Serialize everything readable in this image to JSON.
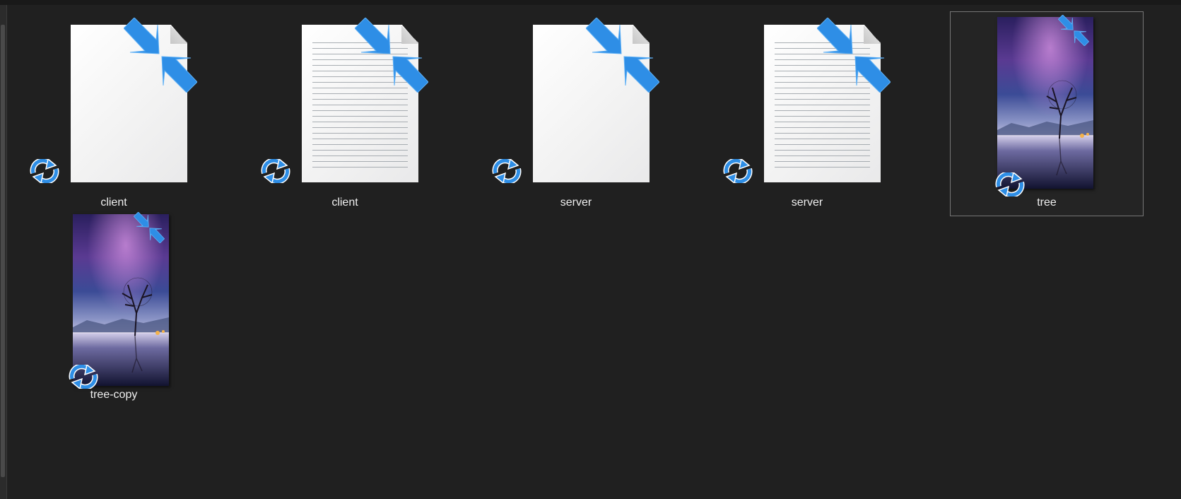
{
  "colors": {
    "background": "#202020",
    "overlay_blue": "#2e8ee6",
    "label_text": "#f0f0f0",
    "selection_border": "#767676"
  },
  "icons": {
    "compress": "compressed-arrows-icon",
    "sync": "sync-icon"
  },
  "files": [
    {
      "name": "client",
      "kind": "blank-document"
    },
    {
      "name": "client",
      "kind": "text-document"
    },
    {
      "name": "server",
      "kind": "blank-document"
    },
    {
      "name": "server",
      "kind": "text-document"
    },
    {
      "name": "tree",
      "kind": "image",
      "selected": true
    },
    {
      "name": "tree-copy",
      "kind": "image"
    }
  ]
}
